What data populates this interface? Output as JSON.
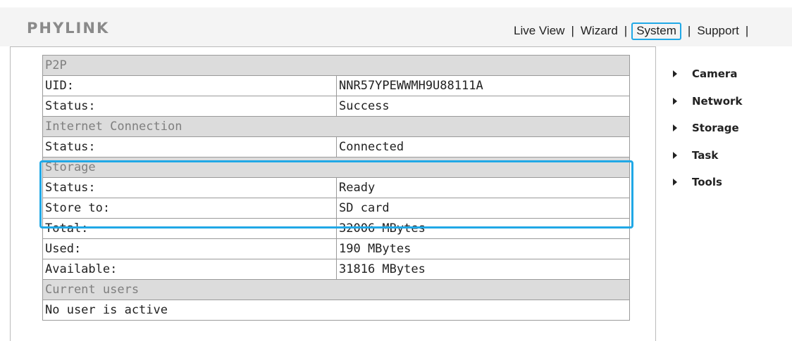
{
  "brand": {
    "logo_text": "PHYLINK"
  },
  "topnav": {
    "items": [
      "Live View",
      "Wizard",
      "System",
      "Support"
    ],
    "separator": "|",
    "active": "System"
  },
  "info_table": {
    "sections": [
      {
        "title": "P2P",
        "rows": [
          [
            "UID:",
            "NNR57YPEWWMH9U88111A"
          ],
          [
            "Status:",
            "Success"
          ]
        ]
      },
      {
        "title": "Internet Connection",
        "rows": [
          [
            "Status:",
            "Connected"
          ]
        ]
      },
      {
        "title": "Storage",
        "rows": [
          [
            "Status:",
            "Ready"
          ],
          [
            "Store to:",
            "SD card"
          ],
          [
            "Total:",
            "32006 MBytes"
          ],
          [
            "Used:",
            "190 MBytes"
          ],
          [
            "Available:",
            "31816 MBytes"
          ]
        ]
      },
      {
        "title": "Current users",
        "rows": [
          [
            "No user is active",
            ""
          ]
        ]
      }
    ]
  },
  "side_menu": {
    "items": [
      "Camera",
      "Network",
      "Storage",
      "Task",
      "Tools"
    ]
  },
  "colors": {
    "highlight": "#20a8e6",
    "section_bg": "#dcdcdc",
    "section_text": "#7f7f7f"
  }
}
